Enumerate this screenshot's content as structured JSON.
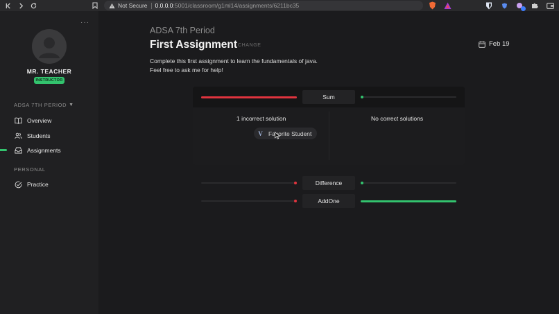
{
  "browser": {
    "security_label": "Not Secure",
    "url_host": "0.0.0.0",
    "url_path": ":5001/classroom/g1ml14/assignments/6211bc35"
  },
  "sidebar": {
    "teacher_name": "MR. TEACHER",
    "role_badge": "INSTRUCTOR",
    "class_section": "ADSA 7TH PERIOD",
    "class_items": [
      {
        "label": "Overview",
        "icon": "book-icon"
      },
      {
        "label": "Students",
        "icon": "users-icon"
      },
      {
        "label": "Assignments",
        "icon": "inbox-icon",
        "active": true
      }
    ],
    "personal_section": "PERSONAL",
    "personal_items": [
      {
        "label": "Practice",
        "icon": "check-circle-icon"
      }
    ]
  },
  "main": {
    "class_title": "ADSA 7th Period",
    "assignment_title": "First Assignment",
    "change_label": "CHANGE",
    "due_date": "Feb 19",
    "description_lines": [
      "Complete this first assignment to learn the fundamentals of java.",
      "Feel free to ask me for help!"
    ]
  },
  "tests": [
    {
      "name": "Sum",
      "incorrect_fraction": 1.0,
      "correct_fraction": 0.0,
      "expanded": true
    },
    {
      "name": "Difference",
      "incorrect_fraction": 0.0,
      "correct_fraction": 0.0,
      "expanded": false
    },
    {
      "name": "AddOne",
      "incorrect_fraction": 0.0,
      "correct_fraction": 1.0,
      "expanded": false
    }
  ],
  "expanded_detail": {
    "incorrect_heading": "1 incorrect solution",
    "correct_heading": "No correct solutions",
    "student_initial": "V",
    "student_name": "Favorite Student"
  },
  "colors": {
    "accent_green": "#33c36e",
    "error_red": "#e0343e",
    "background": "#1b1b1d",
    "sidebar": "#202022"
  }
}
